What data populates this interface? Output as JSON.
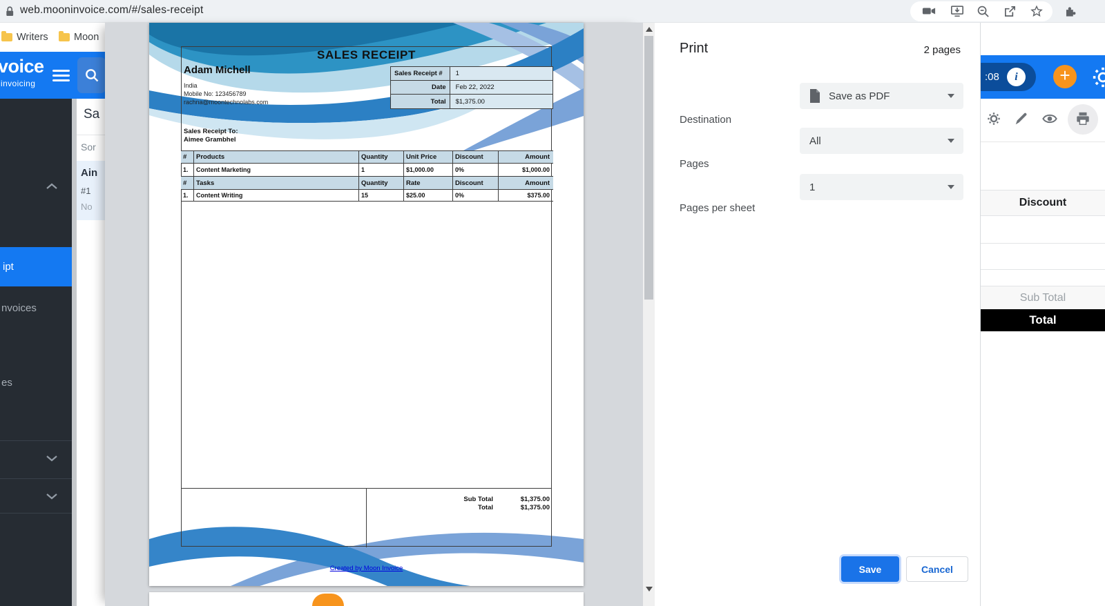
{
  "browser": {
    "url": "web.mooninvoice.com/#/sales-receipt",
    "bookmarks": [
      "Writers",
      "Moon"
    ]
  },
  "app": {
    "logo_main": "voice",
    "logo_sub": "invoicing",
    "timer": ":08",
    "info_glyph": "i",
    "plus_glyph": "+",
    "sidebar": {
      "active": "ipt",
      "item_invoices": "nvoices",
      "item_es": "es"
    },
    "list": {
      "title": "Sa",
      "sort": "Sor",
      "item_name": "Ain",
      "item_number": "#1",
      "item_note": "No"
    },
    "table": {
      "discount": "Discount",
      "subtotal": "Sub Total",
      "total": "Total"
    }
  },
  "doc": {
    "title": "SALES RECEIPT",
    "company": "Adam Michell",
    "country": "India",
    "mobile": "Mobile No: 123456789",
    "email": "rachna@moontechnolabs.com",
    "info": [
      {
        "label": "Sales Receipt #",
        "value": "1"
      },
      {
        "label": "Date",
        "value": "Feb 22, 2022"
      },
      {
        "label": "Total",
        "value": "$1,375.00"
      }
    ],
    "bill_to_label": "Sales Receipt To:",
    "bill_to_name": "Aimee Grambhel",
    "products": {
      "headers": [
        "#",
        "Products",
        "Quantity",
        "Unit Price",
        "Discount",
        "Amount"
      ],
      "row": [
        "1.",
        "Content Marketing",
        "1",
        "$1,000.00",
        "0%",
        "$1,000.00"
      ]
    },
    "tasks": {
      "headers": [
        "#",
        "Tasks",
        "Quantity",
        "Rate",
        "Discount",
        "Amount"
      ],
      "row": [
        "1.",
        "Content Writing",
        "15",
        "$25.00",
        "0%",
        "$375.00"
      ]
    },
    "totals": [
      {
        "label": "Sub Total",
        "value": "$1,375.00"
      },
      {
        "label": "Total",
        "value": "$1,375.00"
      }
    ],
    "footer_link": "Created by Moon Invoice"
  },
  "print": {
    "title": "Print",
    "pages_count": "2 pages",
    "destination_label": "Destination",
    "destination_value": "Save as PDF",
    "pages_label": "Pages",
    "pages_value": "All",
    "per_sheet_label": "Pages per sheet",
    "per_sheet_value": "1",
    "save": "Save",
    "cancel": "Cancel"
  },
  "colors": {
    "accent": "#1479f2",
    "navy": "#0b4d9b",
    "orange": "#f7941d",
    "save_blue": "#1a73e8",
    "doc_header_bg": "#c6dae6",
    "total_black": "#000000"
  }
}
